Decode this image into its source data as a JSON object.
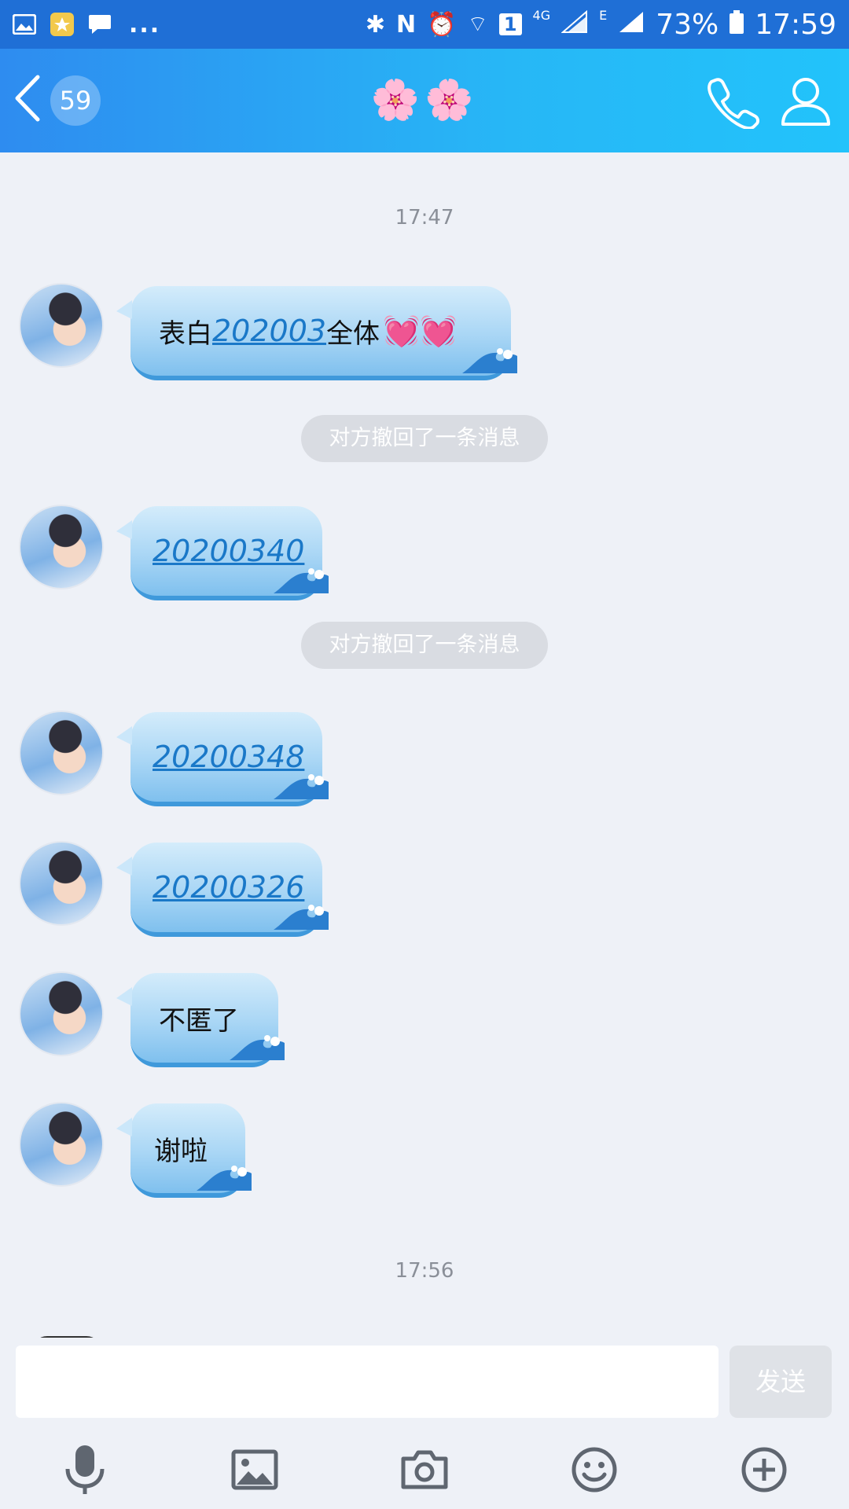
{
  "status_bar": {
    "signal_label": "4G",
    "network_label": "E",
    "battery": "73%",
    "time": "17:59",
    "sim": "1",
    "dots": "..."
  },
  "header": {
    "unread_count": "59",
    "title": "🌸🌸"
  },
  "chat": {
    "time_1": "17:47",
    "time_2": "17:56",
    "recall_1": "对方撤回了一条消息",
    "recall_2": "对方撤回了一条消息",
    "messages": [
      {
        "prefix": "表白",
        "link": "202003",
        "suffix": "全体",
        "emoji": "💓💓"
      },
      {
        "link": "20200340"
      },
      {
        "link": "20200348"
      },
      {
        "link": "20200326"
      },
      {
        "text": "不匿了"
      },
      {
        "text": "谢啦"
      }
    ]
  },
  "input": {
    "placeholder": "",
    "send_label": "发送"
  },
  "icons": {
    "back": "chevron-left-icon",
    "call": "phone-icon",
    "profile": "person-icon",
    "voice": "microphone-icon",
    "image": "image-icon",
    "camera": "camera-icon",
    "emoji": "smiley-icon",
    "more": "plus-circle-icon"
  },
  "colors": {
    "header_start": "#2e8cf0",
    "header_end": "#22c3fb",
    "status_bar": "#1f6fd6",
    "link": "#1a78c8",
    "background": "#eef1f7"
  }
}
